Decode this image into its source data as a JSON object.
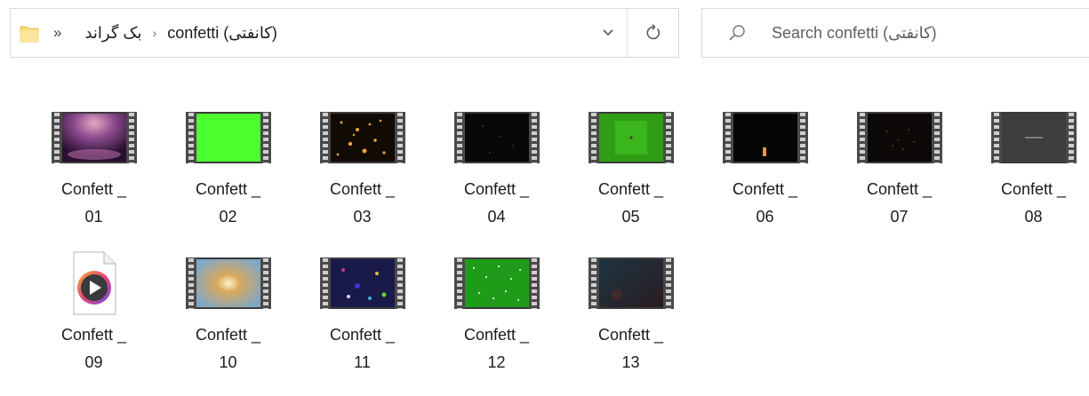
{
  "address_bar": {
    "overflow": "»",
    "breadcrumbs": [
      {
        "label": "بک گراند"
      },
      {
        "label": "confetti (کانفتی)"
      }
    ],
    "separator": "›"
  },
  "search": {
    "placeholder": "Search confetti (کانفتی)"
  },
  "files": [
    {
      "line1": "Confett _",
      "line2": "01",
      "thumb": "purple-spotlight"
    },
    {
      "line1": "Confett _",
      "line2": "02",
      "thumb": "green-screen"
    },
    {
      "line1": "Confett _",
      "line2": "03",
      "thumb": "gold-bokeh"
    },
    {
      "line1": "Confett _",
      "line2": "04",
      "thumb": "dark-sparkle"
    },
    {
      "line1": "Confett _",
      "line2": "05",
      "thumb": "green-confetti"
    },
    {
      "line1": "Confett _",
      "line2": "06",
      "thumb": "black-candle"
    },
    {
      "line1": "Confett _",
      "line2": "07",
      "thumb": "dark-sparkle-red"
    },
    {
      "line1": "Confett _",
      "line2": "08",
      "thumb": "gray-line"
    },
    {
      "line1": "Confett _",
      "line2": "09",
      "thumb": "media-player-icon"
    },
    {
      "line1": "Confett _",
      "line2": "10",
      "thumb": "blue-gold-burst"
    },
    {
      "line1": "Confett _",
      "line2": "11",
      "thumb": "blue-purple-confetti"
    },
    {
      "line1": "Confett _",
      "line2": "12",
      "thumb": "green-white-confetti"
    },
    {
      "line1": "Confett _",
      "line2": "13",
      "thumb": "dark-teal"
    }
  ],
  "colors": {
    "border": "#d9d9d9",
    "text": "#1b1b1b",
    "folder_yellow": "#f8d775",
    "film_strip": "#4a4a4a"
  }
}
